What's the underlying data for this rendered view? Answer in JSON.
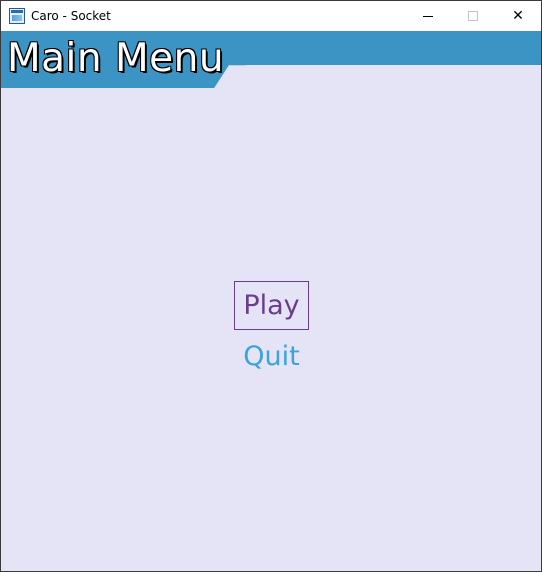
{
  "window": {
    "title": "Caro - Socket",
    "controls": {
      "minimize": "minimize",
      "maximize": "maximize",
      "close": "✕"
    }
  },
  "header": {
    "title": "Main Menu"
  },
  "menu": {
    "items": [
      {
        "label": "Play",
        "selected": true
      },
      {
        "label": "Quit",
        "selected": false
      }
    ]
  },
  "colors": {
    "background": "#e4e4f6",
    "header": "#3c94c5",
    "selected_item": "#6a3d8e",
    "unselected_item": "#3ca4d6"
  }
}
